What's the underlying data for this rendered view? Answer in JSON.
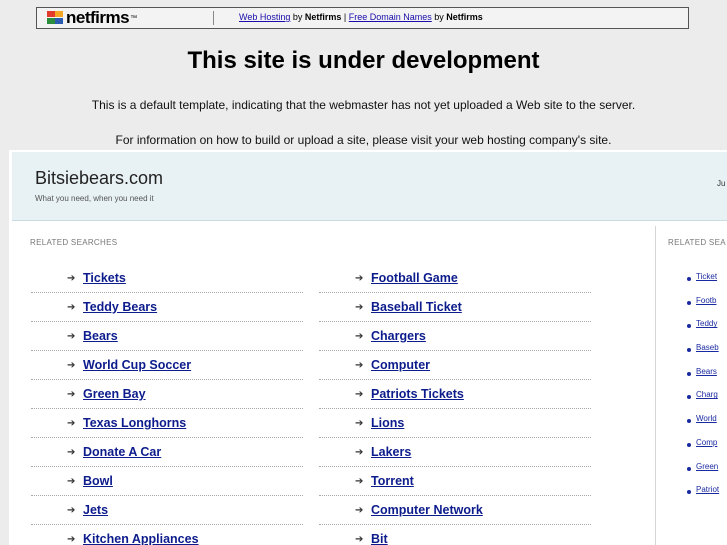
{
  "banner": {
    "logo_text": "netfirms",
    "links": [
      {
        "label": "Web Hosting",
        "suffix": " by ",
        "brand": "Netfirms"
      },
      {
        "label": "Free Domain Names",
        "suffix": " by ",
        "brand": "Netfirms"
      }
    ],
    "separator": " | "
  },
  "headline": "This site is under development",
  "sub1": "This is a default template, indicating that the webmaster has not yet uploaded a Web site to the server.",
  "sub2": "For information on how to build or upload a site, please visit your web hosting company's site.",
  "site": {
    "title": "Bitsiebears.com",
    "tagline": "What you need, when you need it",
    "header_right": "Ju"
  },
  "related": {
    "main_label": "RELATED SEARCHES",
    "side_label": "RELATED SEA",
    "left": [
      "Tickets",
      "Teddy Bears",
      "Bears",
      "World Cup Soccer",
      "Green Bay",
      "Texas Longhorns",
      "Donate A Car",
      "Bowl",
      "Jets",
      "Kitchen Appliances"
    ],
    "right": [
      "Football Game",
      "Baseball Ticket",
      "Chargers",
      "Computer",
      "Patriots Tickets",
      "Lions",
      "Lakers",
      "Torrent",
      "Computer Network",
      "Bit"
    ],
    "side": [
      "Ticket",
      "Footb",
      "Teddy",
      "Baseb",
      "Bears",
      "Charg",
      "World",
      "Comp",
      "Green",
      "Patriot"
    ]
  },
  "colors": {
    "link": "#0d1c8c",
    "header_bg": "#e8f1f3",
    "page_bg": "#ececec"
  }
}
